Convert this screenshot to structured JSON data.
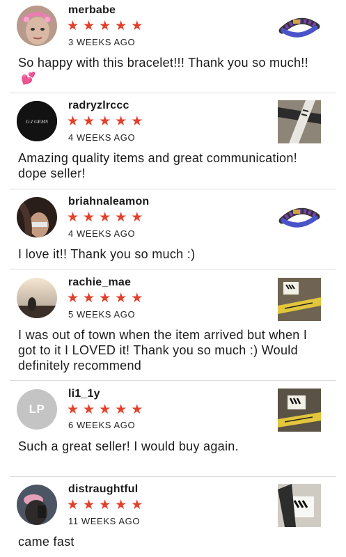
{
  "reviews": [
    {
      "username": "merbabe",
      "rating": 5,
      "stars": [
        "★",
        "★",
        "★",
        "★",
        "★"
      ],
      "time_ago": "3 WEEKS AGO",
      "text": "So happy with this bracelet!!! Thank you so much!!",
      "emoji": "💕",
      "avatar": "photo",
      "product_thumb": "bracelet"
    },
    {
      "username": "radryzlrccc",
      "rating": 5,
      "stars": [
        "★",
        "★",
        "★",
        "★",
        "★"
      ],
      "time_ago": "4 WEEKS AGO",
      "text": "Amazing  quality items and great communication! dope seller!",
      "avatar_text": "G.I GEMS",
      "product_thumb": "strap"
    },
    {
      "username": "briahnaleamon",
      "rating": 5,
      "stars": [
        "★",
        "★",
        "★",
        "★",
        "★"
      ],
      "time_ago": "4 WEEKS AGO",
      "text": "I love it!! Thank you so much :)",
      "avatar": "photo",
      "product_thumb": "bracelet"
    },
    {
      "username": "rachie_mae",
      "rating": 5,
      "stars": [
        "★",
        "★",
        "★",
        "★",
        "★"
      ],
      "time_ago": "5 WEEKS AGO",
      "text": "I was out of town when the item arrived but when I got to it I LOVED it! Thank you so much :) Would definitely recommend",
      "avatar": "photo",
      "product_thumb": "tag"
    },
    {
      "username": "li1_1y",
      "rating": 5,
      "stars": [
        "★",
        "★",
        "★",
        "★",
        "★"
      ],
      "time_ago": "6 WEEKS AGO",
      "text": "Such a great seller! I would buy again.",
      "avatar_initials": "LP",
      "product_thumb": "tag"
    },
    {
      "username": "distraughtful",
      "rating": 5,
      "stars": [
        "★",
        "★",
        "★",
        "★",
        "★"
      ],
      "time_ago": "11 WEEKS AGO",
      "text": "came fast",
      "avatar": "photo",
      "product_thumb": "tag"
    }
  ],
  "colors": {
    "star": "#e4412c",
    "divider": "#dcdcdc",
    "initials_avatar_bg": "#c4c4c4"
  }
}
